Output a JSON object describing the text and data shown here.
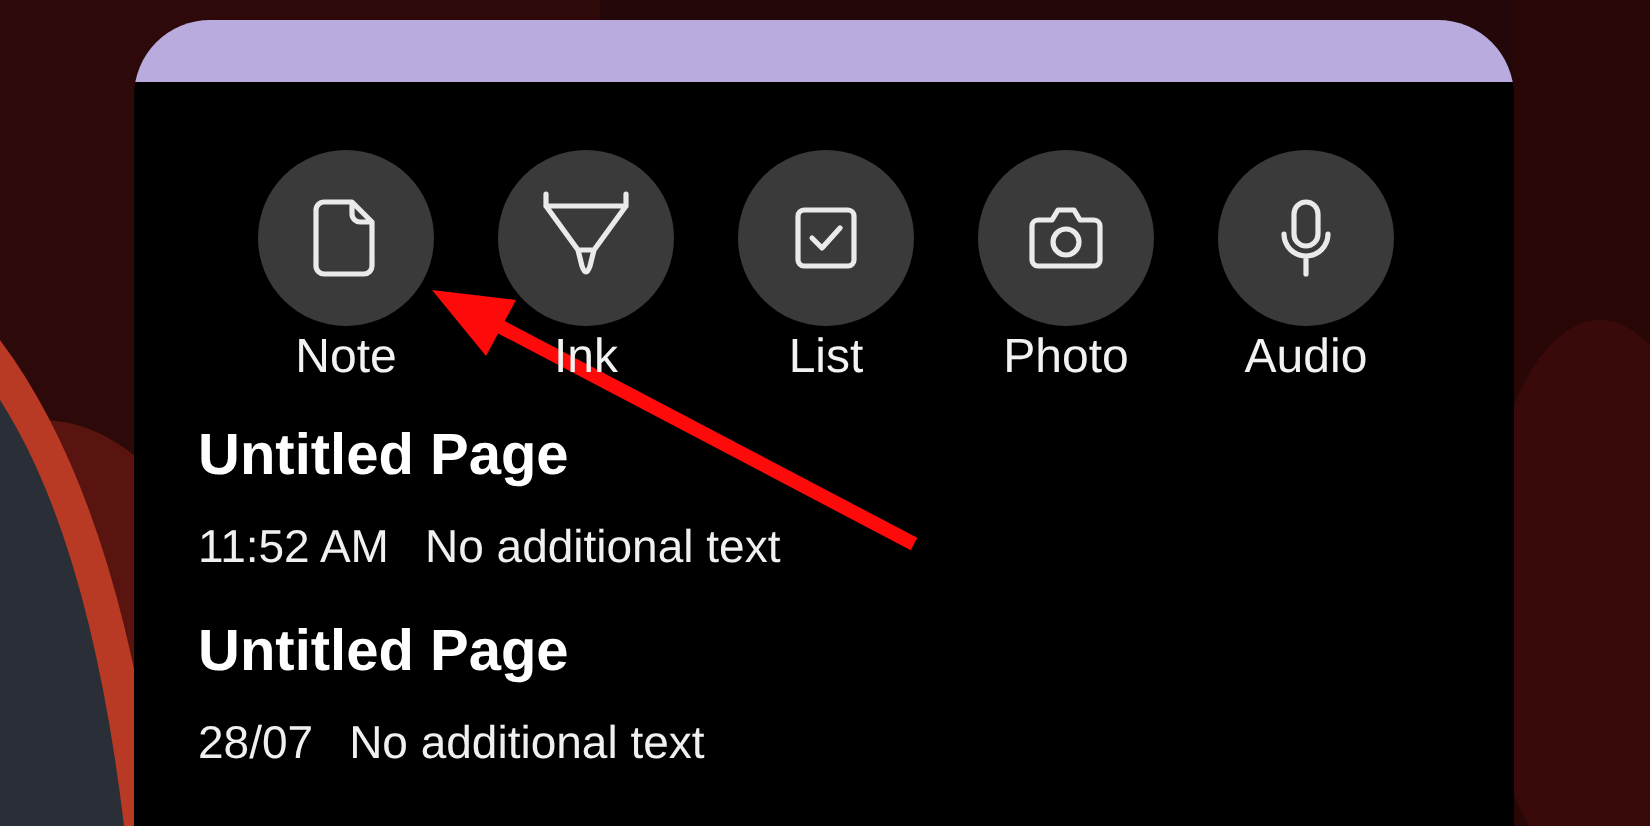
{
  "actions": [
    {
      "label": "Note",
      "kind": "note"
    },
    {
      "label": "Ink",
      "kind": "ink"
    },
    {
      "label": "List",
      "kind": "list"
    },
    {
      "label": "Photo"
    },
    {
      "label": "Audio",
      "kind": "audio"
    }
  ],
  "pages": [
    {
      "title": "Untitled Page",
      "time": "11:52 AM",
      "preview": "No additional text"
    },
    {
      "title": "Untitled Page",
      "time": "28/07",
      "preview": "No additional text"
    }
  ],
  "annotation": {
    "kind": "arrow"
  }
}
